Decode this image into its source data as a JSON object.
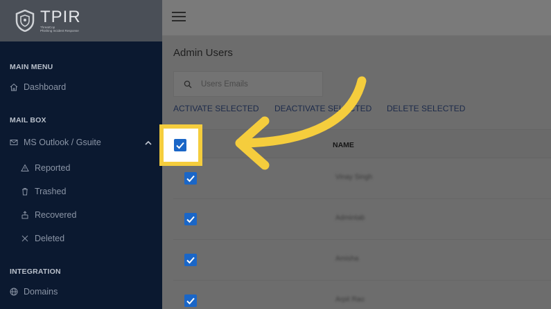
{
  "brand": {
    "name": "TPIR",
    "tagline_1": "ThreatCop",
    "tagline_2": "Phishing Incident Response"
  },
  "sidebar": {
    "main_menu_title": "MAIN MENU",
    "dashboard": "Dashboard",
    "mailbox_title": "MAIL BOX",
    "ms_outlook": "MS Outlook / Gsuite",
    "reported": "Reported",
    "trashed": "Trashed",
    "recovered": "Recovered",
    "deleted": "Deleted",
    "integration_title": "INTEGRATION",
    "domains": "Domains"
  },
  "main": {
    "title": "Admin Users",
    "search_placeholder": "Users Emails",
    "actions": {
      "activate": "ACTIVATE SELECTED",
      "deactivate": "DEACTIVATE SELECTED",
      "delete": "DELETE SELECTED"
    },
    "table": {
      "col_name": "NAME",
      "rows": [
        {
          "name": "Vinay Singh"
        },
        {
          "name": "Admintab"
        },
        {
          "name": "Amisha"
        },
        {
          "name": "Arpit Rao"
        }
      ]
    }
  },
  "colors": {
    "highlight": "#f5cd3d",
    "checkbox": "#1a66c7",
    "sidebar_bg": "#0b1930"
  }
}
